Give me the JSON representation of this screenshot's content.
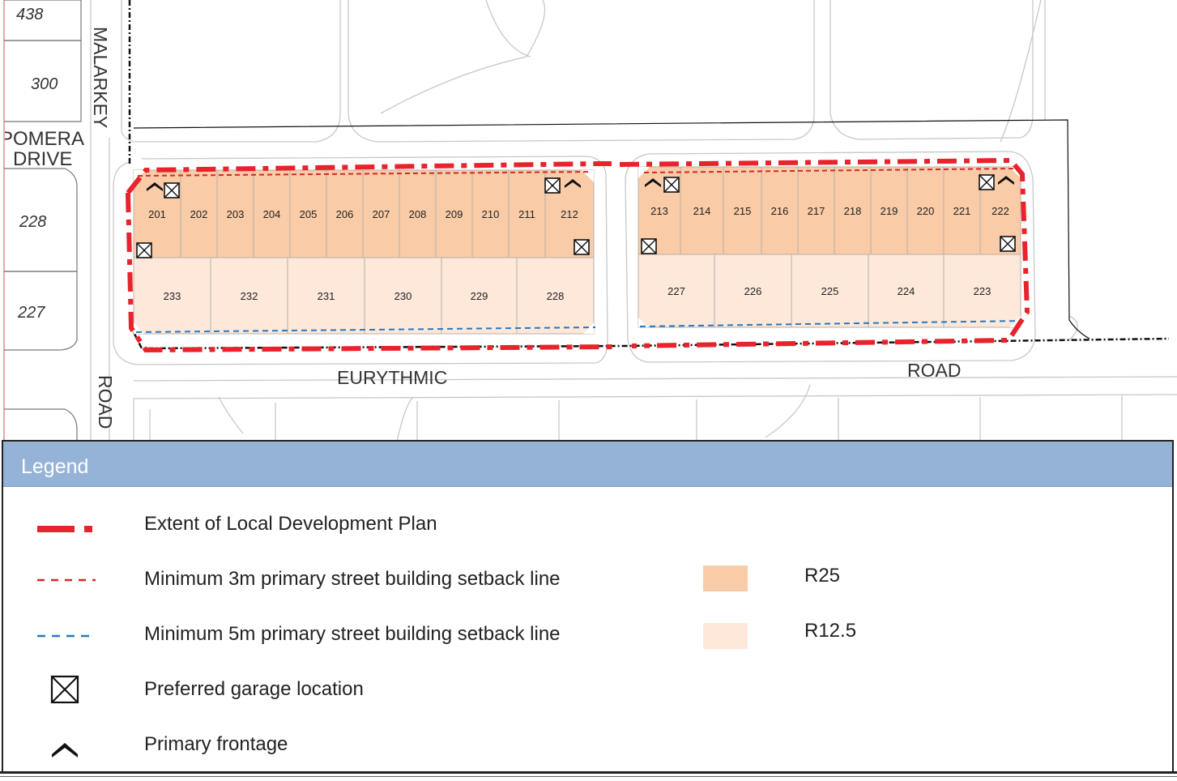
{
  "colors": {
    "r25": "#f9cba6",
    "r125": "#fde8da",
    "extent_line": "#e8232b",
    "setback3": "#d12a2a",
    "setback5": "#2878bf",
    "legend_header": "#95b3d7",
    "road_outline": "#c8c8c8",
    "boundary": "#111111"
  },
  "map": {
    "streets": {
      "malarkey": "MALARKEY",
      "road_vertical": "ROAD",
      "pomera": "POMERA",
      "drive": "DRIVE",
      "eurythmic": "EURYTHMIC",
      "road_horizontal": "ROAD"
    },
    "existing_lots": [
      "438",
      "300",
      "228",
      "227"
    ],
    "west_block": {
      "r25_lots": [
        "201",
        "202",
        "203",
        "204",
        "205",
        "206",
        "207",
        "208",
        "209",
        "210",
        "211",
        "212"
      ],
      "r125_lots": [
        "233",
        "232",
        "231",
        "230",
        "229",
        "228"
      ]
    },
    "east_block": {
      "r25_lots": [
        "213",
        "214",
        "215",
        "216",
        "217",
        "218",
        "219",
        "220",
        "221",
        "222"
      ],
      "r125_lots": [
        "227",
        "226",
        "225",
        "224",
        "223"
      ]
    },
    "garage_icon": "box-cross-icon",
    "frontage_icon": "chevron-up-icon"
  },
  "legend": {
    "title": "Legend",
    "items": [
      {
        "label": "Extent of Local Development Plan",
        "icon": "dash-dot-line-icon"
      },
      {
        "label": "Minimum 3m primary street building setback line",
        "icon": "red-dashed-line-icon"
      },
      {
        "label": "Minimum 5m primary street building setback line",
        "icon": "blue-dashed-line-icon"
      },
      {
        "label": "Preferred garage location",
        "icon": "box-cross-icon"
      },
      {
        "label": "Primary frontage",
        "icon": "chevron-up-icon"
      }
    ],
    "swatches": [
      {
        "label": "R25",
        "color": "#f9cba6"
      },
      {
        "label": "R12.5",
        "color": "#fde8da"
      }
    ]
  }
}
